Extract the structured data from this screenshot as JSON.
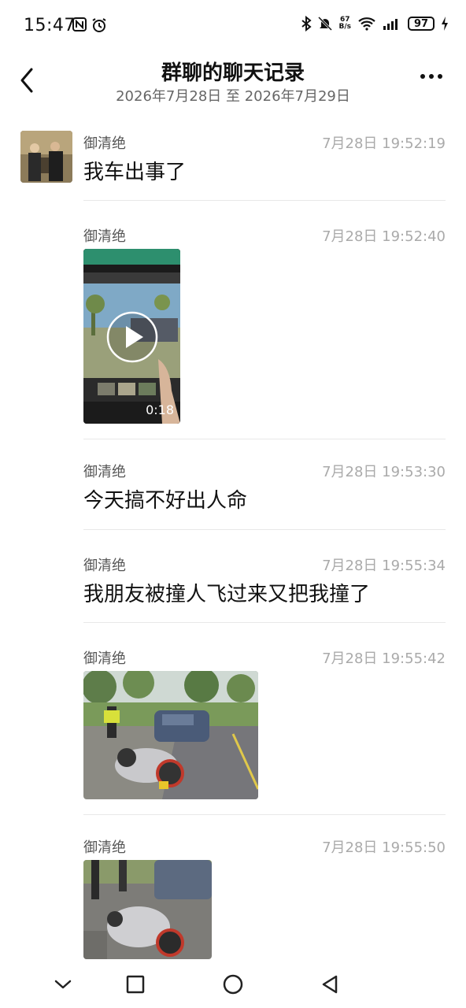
{
  "status_bar": {
    "time": "15:47",
    "left_icons": [
      "n-icon",
      "alarm-icon"
    ],
    "net_speed_value": "67",
    "net_speed_unit": "B/s",
    "battery": "97"
  },
  "header": {
    "title": "群聊的聊天记录",
    "subtitle": "2026年7月28日 至 2026年7月29日"
  },
  "messages": [
    {
      "sender": "御清绝",
      "time": "7月28日 19:52:19",
      "type": "text",
      "text": "我车出事了"
    },
    {
      "sender": "御清绝",
      "time": "7月28日 19:52:40",
      "type": "video",
      "duration": "0:18"
    },
    {
      "sender": "御清绝",
      "time": "7月28日 19:53:30",
      "type": "text",
      "text": "今天搞不好出人命"
    },
    {
      "sender": "御清绝",
      "time": "7月28日 19:55:34",
      "type": "text",
      "text": "我朋友被撞人飞过来又把我撞了"
    },
    {
      "sender": "御清绝",
      "time": "7月28日 19:55:42",
      "type": "image"
    },
    {
      "sender": "御清绝",
      "time": "7月28日 19:55:50",
      "type": "image"
    }
  ],
  "nav_bar": {
    "icons": [
      "chevron-down-icon",
      "square-icon",
      "circle-icon",
      "triangle-back-icon"
    ]
  }
}
